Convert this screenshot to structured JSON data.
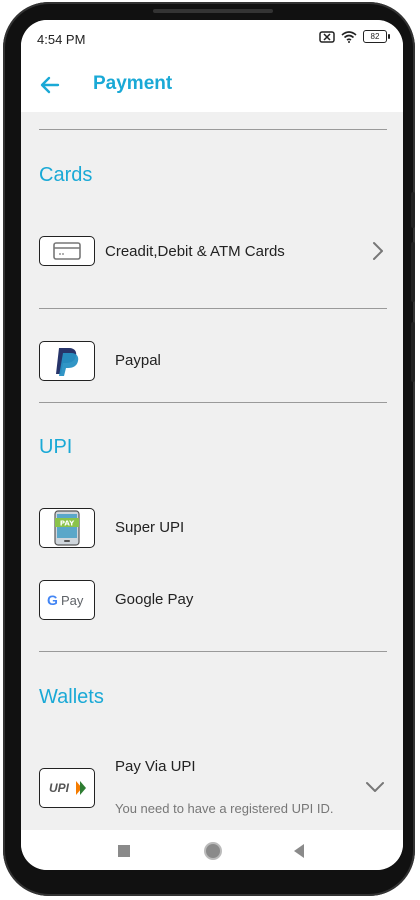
{
  "status_bar": {
    "time": "4:54 PM",
    "battery": "82"
  },
  "header": {
    "title": "Payment"
  },
  "sections": {
    "cards": {
      "title": "Cards",
      "items": [
        {
          "label": "Creadit,Debit & ATM Cards",
          "icon": "credit-card-icon"
        }
      ]
    },
    "paypal": {
      "label": "Paypal",
      "icon": "paypal-logo-icon"
    },
    "upi": {
      "title": "UPI",
      "items": [
        {
          "label": "Super UPI",
          "icon": "super-upi-phone-icon",
          "badge": "PAY"
        },
        {
          "label": "Google Pay",
          "icon": "google-pay-logo-icon",
          "logo_text": "Pay"
        }
      ]
    },
    "wallets": {
      "title": "Wallets",
      "items": [
        {
          "label": "Pay Via UPI",
          "subtitle": "You need to have a registered UPI ID.",
          "icon": "upi-logo-icon",
          "logo_text": "UPI"
        }
      ]
    }
  },
  "colors": {
    "accent": "#1aa9d6",
    "background": "#f0f0f0",
    "divider": "#9a9a9a"
  }
}
